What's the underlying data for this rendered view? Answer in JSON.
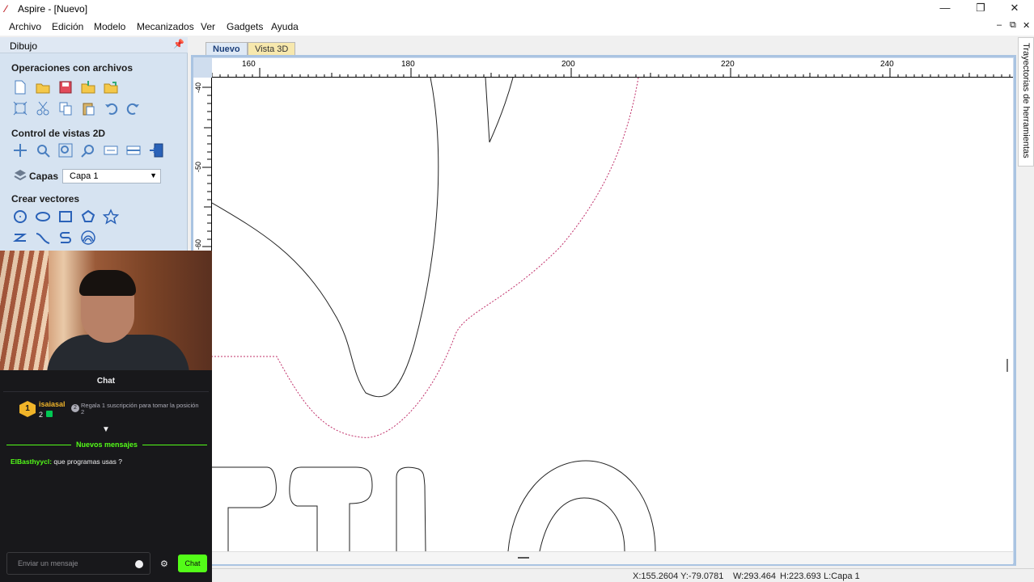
{
  "window": {
    "title": "Aspire - [Nuevo]",
    "minimize": "—",
    "restore": "❐",
    "close": "✕"
  },
  "menu": {
    "items": [
      "Archivo",
      "Edición",
      "Modelo",
      "Mecanizados",
      "Ver",
      "Gadgets",
      "Ayuda"
    ],
    "mdi_min": "‒",
    "mdi_restore": "⧉",
    "mdi_close": "✕"
  },
  "left_panel": {
    "title": "Dibujo",
    "sections": {
      "files": "Operaciones con archivos",
      "view2d": "Control de vistas 2D",
      "layers_label": "Capas",
      "layer_value": "Capa 1",
      "vectors": "Crear vectores"
    }
  },
  "tabs": [
    "Nuevo",
    "Vista 3D"
  ],
  "ruler": {
    "top_ticks": [
      "160",
      "180",
      "200",
      "220",
      "240"
    ],
    "left_ticks": [
      "-40",
      "-50",
      "-60"
    ]
  },
  "right_panel": {
    "label": "Trayectorias de herramientas"
  },
  "status": {
    "coords": "X:155.2604 Y:-79.0781",
    "width": "W:293.464",
    "height": "H:223.693",
    "layer": "L:Capa 1"
  },
  "chat": {
    "title": "Chat",
    "top_rank": "1",
    "top_user": "isaiasal",
    "top_count": "2",
    "promo": "Regala 1 suscripción para tomar la posición 2",
    "new_messages": "Nuevos mensajes",
    "messages": [
      {
        "user": "ElBasthyycl:",
        "text": "que programas usas ?"
      }
    ],
    "input_placeholder": "Enviar un mensaje",
    "send_label": "Chat"
  },
  "colors": {
    "accent_green": "#53fc18",
    "dashed_vector": "#c0306a",
    "panel_bg": "#d6e3f1"
  }
}
